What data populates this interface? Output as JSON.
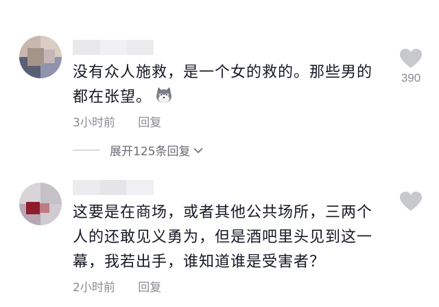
{
  "comments": [
    {
      "text_line1": "没有众人施救，是一个女的救的。那些男的",
      "text_line2": "都在张望。",
      "emoji_icon": "cat-face-emoji",
      "time": "3小时前",
      "reply_label": "回复",
      "likes": "390",
      "expand_label": "展开125条回复"
    },
    {
      "text_line1": "这要是在商场，或者其他公共场所，三两个",
      "text_line2": "人的还敢见义勇为，但是酒吧里头见到这一",
      "text_line3": "幕，我若出手，谁知道谁是受害者？",
      "time": "2小时前",
      "reply_label": "回复"
    }
  ],
  "colors": {
    "text": "#161823",
    "meta": "#8a8b91",
    "like_icon": "#c8c9cc"
  }
}
